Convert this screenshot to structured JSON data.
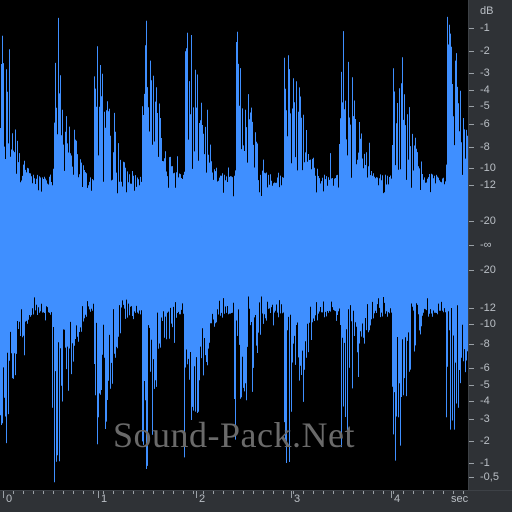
{
  "colors": {
    "waveform": "#3f8fff",
    "background": "#000000",
    "ruler_bg": "#2f3236",
    "ruler_text": "#b9bec4"
  },
  "db_scale": {
    "unit": "dB",
    "labels": [
      "-1",
      "-2",
      "-3",
      "-4",
      "-5",
      "-6",
      "-8",
      "-10",
      "-12",
      "-20",
      "-∞",
      "-20",
      "-12",
      "-10",
      "-8",
      "-6",
      "-5",
      "-4",
      "-3",
      "-2",
      "-1",
      "-0,5"
    ]
  },
  "time_scale": {
    "unit": "sec",
    "labels": [
      "0",
      "1",
      "2",
      "3",
      "4"
    ],
    "max_seconds": 4.65
  },
  "watermark": "Sound-Pack.Net",
  "waveform_envelope": {
    "note": "peak amplitude (0-1) per segment, as displayed",
    "peaks": [
      0.98,
      0.92,
      0.95,
      0.88,
      0.97,
      0.9,
      0.85,
      0.93,
      0.96,
      0.89,
      0.94,
      0.9,
      0.86,
      0.8,
      0.95,
      0.91
    ]
  }
}
